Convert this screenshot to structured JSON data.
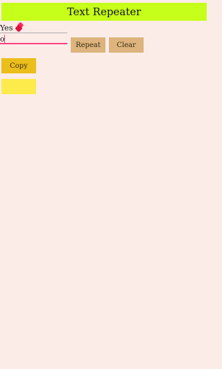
{
  "header": {
    "title": "Text Repeater"
  },
  "input": {
    "text_value": "Yes",
    "text_emoji": "heart-emoji",
    "count_value": "o"
  },
  "buttons": {
    "repeat_label": "Repeat",
    "clear_label": "Clear",
    "copy_label": "Copy"
  },
  "output": {
    "value": ""
  },
  "colors": {
    "background": "#fbece8",
    "header": "#c6ff1a",
    "accent": "#ff4081",
    "button": "#ddb47d",
    "copy_button": "#ebbe1c",
    "output_box": "#fdeb4c"
  }
}
